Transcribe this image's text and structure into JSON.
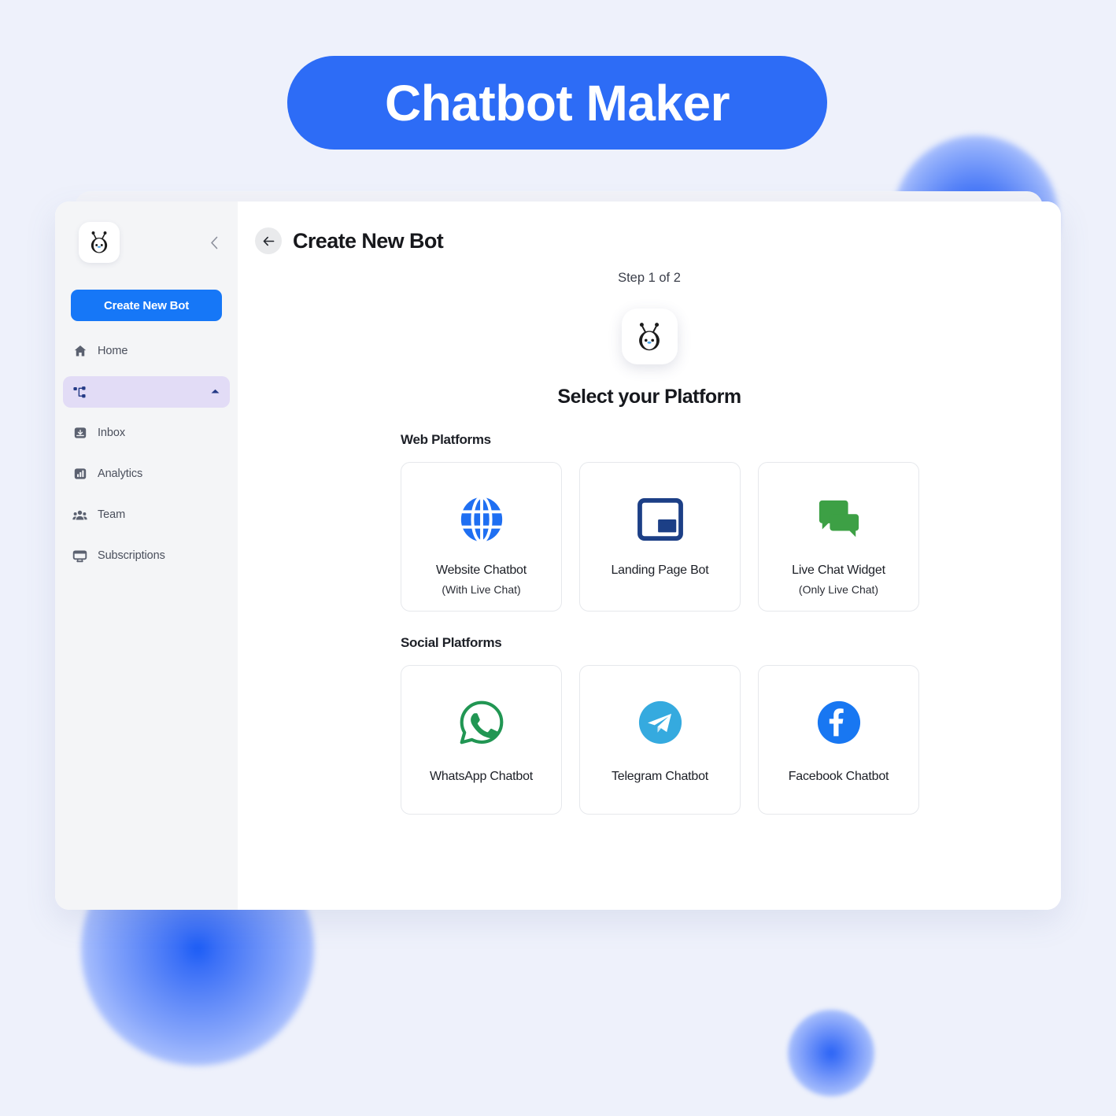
{
  "banner": {
    "title": "Chatbot Maker",
    "color": "#2d6cf6"
  },
  "page": {
    "background": "#eef1fb"
  },
  "sidebar": {
    "logo_icon": "bot-penguin-logo",
    "collapse_icon": "chevron-left-icon",
    "create_button": "Create New Bot",
    "items": [
      {
        "label": "Home",
        "icon": "home-icon",
        "active": false
      },
      {
        "label": "",
        "icon": "flow-hierarchy-icon",
        "active": true,
        "chevron": "chevron-up-icon"
      },
      {
        "label": "Inbox",
        "icon": "inbox-icon",
        "active": false
      },
      {
        "label": "Analytics",
        "icon": "analytics-bar-chart-icon",
        "active": false
      },
      {
        "label": "Team",
        "icon": "team-people-icon",
        "active": false
      },
      {
        "label": "Subscriptions",
        "icon": "monitor-icon",
        "active": false
      }
    ]
  },
  "header": {
    "back_icon": "arrow-left-icon",
    "title": "Create New Bot"
  },
  "main": {
    "step": "Step 1 of 2",
    "bot_icon": "bot-penguin-logo",
    "heading": "Select your Platform",
    "sections": [
      {
        "label": "Web Platforms",
        "cards": [
          {
            "name": "Website Chatbot",
            "sub": "(With Live Chat)",
            "icon": "globe-icon",
            "color": "#1f6ff2"
          },
          {
            "name": "Landing Page Bot",
            "sub": "",
            "icon": "landing-page-icon",
            "color": "#1c3f86"
          },
          {
            "name": "Live Chat Widget",
            "sub": "(Only Live Chat)",
            "icon": "chat-bubbles-icon",
            "color": "#3da045"
          }
        ]
      },
      {
        "label": "Social Platforms",
        "cards": [
          {
            "name": "WhatsApp Chatbot",
            "sub": "",
            "icon": "whatsapp-icon",
            "color": "#219653"
          },
          {
            "name": "Telegram Chatbot",
            "sub": "",
            "icon": "telegram-icon",
            "color": "#35aadf"
          },
          {
            "name": "Facebook Chatbot",
            "sub": "",
            "icon": "facebook-icon",
            "color": "#1877f2"
          }
        ]
      }
    ]
  }
}
